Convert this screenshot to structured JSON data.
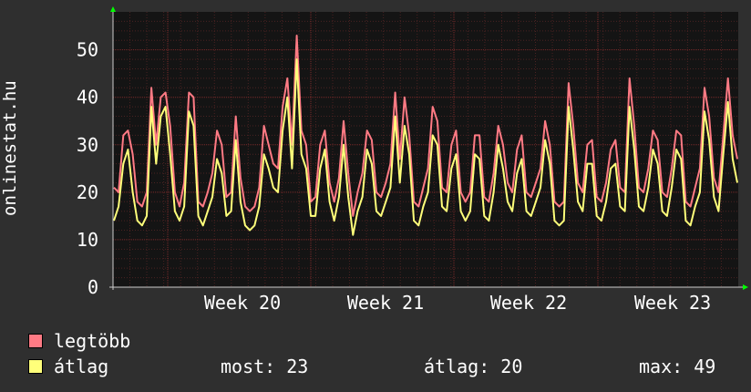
{
  "chart_data": {
    "type": "line",
    "ylabel": "onlinestat.hu",
    "ylim": [
      0,
      58
    ],
    "yticks": [
      0,
      10,
      20,
      30,
      40,
      50
    ],
    "xticks": [
      "Week 20",
      "Week 21",
      "Week 22",
      "Week 23"
    ],
    "grid": true,
    "series": [
      {
        "name": "legtöbb",
        "color": "#ff7a84",
        "values": [
          21,
          20,
          32,
          33,
          28,
          18,
          17,
          20,
          42,
          30,
          40,
          41,
          34,
          20,
          17,
          22,
          41,
          40,
          18,
          17,
          20,
          24,
          33,
          30,
          19,
          20,
          36,
          23,
          17,
          16,
          17,
          21,
          34,
          30,
          26,
          25,
          38,
          44,
          30,
          53,
          33,
          30,
          18,
          19,
          30,
          33,
          22,
          18,
          23,
          35,
          24,
          15,
          20,
          24,
          33,
          31,
          20,
          19,
          22,
          26,
          41,
          27,
          40,
          32,
          18,
          17,
          21,
          25,
          38,
          35,
          21,
          20,
          30,
          33,
          20,
          18,
          20,
          32,
          32,
          19,
          18,
          24,
          34,
          30,
          22,
          20,
          29,
          32,
          20,
          19,
          22,
          25,
          35,
          30,
          18,
          17,
          18,
          43,
          34,
          22,
          20,
          30,
          31,
          19,
          18,
          22,
          29,
          31,
          21,
          20,
          44,
          34,
          21,
          20,
          25,
          33,
          31,
          20,
          19,
          25,
          33,
          32,
          18,
          17,
          21,
          25,
          42,
          36,
          23,
          20,
          32,
          44,
          32,
          27
        ],
        "legend_label": "legtöbb"
      },
      {
        "name": "átlag",
        "color": "#ffff7a",
        "values": [
          14,
          17,
          26,
          29,
          20,
          14,
          13,
          15,
          38,
          26,
          36,
          38,
          28,
          16,
          14,
          17,
          37,
          34,
          15,
          13,
          16,
          19,
          27,
          24,
          15,
          16,
          31,
          18,
          13,
          12,
          13,
          17,
          28,
          25,
          21,
          20,
          33,
          40,
          25,
          48,
          28,
          25,
          15,
          15,
          25,
          29,
          18,
          14,
          19,
          30,
          19,
          11,
          16,
          19,
          29,
          26,
          16,
          15,
          18,
          21,
          36,
          22,
          34,
          28,
          14,
          13,
          17,
          20,
          32,
          30,
          17,
          16,
          25,
          28,
          16,
          14,
          16,
          28,
          27,
          15,
          14,
          20,
          30,
          25,
          18,
          16,
          24,
          27,
          16,
          15,
          18,
          21,
          31,
          26,
          14,
          13,
          14,
          38,
          29,
          18,
          16,
          26,
          26,
          15,
          14,
          18,
          25,
          26,
          17,
          16,
          38,
          29,
          17,
          16,
          21,
          29,
          26,
          16,
          15,
          21,
          29,
          27,
          14,
          13,
          17,
          20,
          37,
          31,
          19,
          16,
          28,
          39,
          27,
          22
        ],
        "legend_label": "átlag"
      }
    ],
    "stats": {
      "now_label": "most:",
      "now_value": "23",
      "avg_label": "átlag:",
      "avg_value": "20",
      "max_label": "max:",
      "max_value": "49"
    },
    "colors": {
      "background": "#2f2f2f",
      "plot_background": "#141414",
      "grid_major": "#7a2a2a",
      "grid_minor": "#4a2222",
      "axis": "#cccccc",
      "arrow": "#00ff00"
    }
  }
}
